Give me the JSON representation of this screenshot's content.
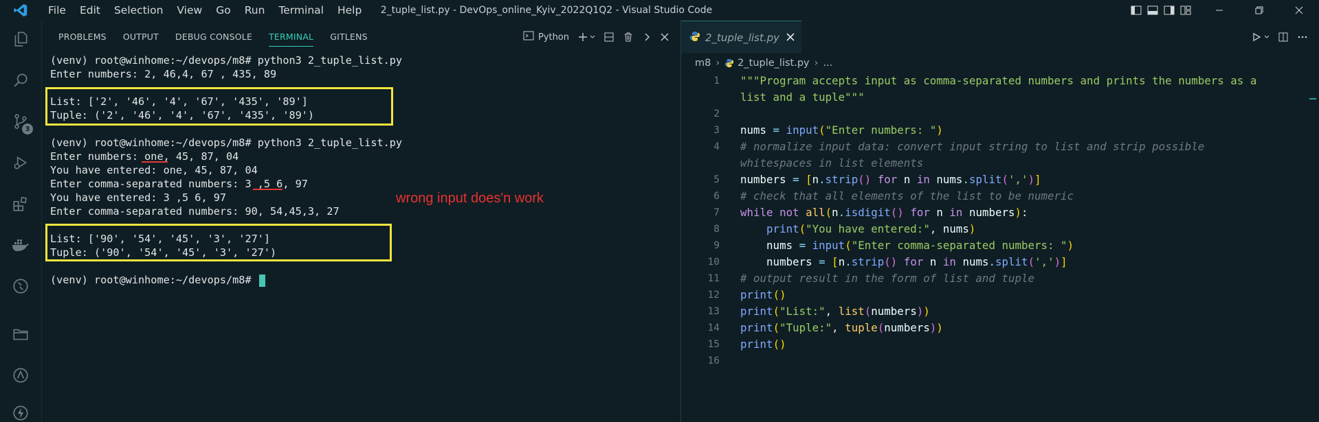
{
  "titlebar": {
    "menu": [
      "File",
      "Edit",
      "Selection",
      "View",
      "Go",
      "Run",
      "Terminal",
      "Help"
    ],
    "window_title": "2_tuple_list.py - DevOps_online_Kyiv_2022Q1Q2 - Visual Studio Code"
  },
  "activity_bar": {
    "source_control_badge": "3"
  },
  "panel": {
    "tabs": [
      "PROBLEMS",
      "OUTPUT",
      "DEBUG CONSOLE",
      "TERMINAL",
      "GITLENS"
    ],
    "active_tab": "TERMINAL",
    "shell_label": "Python"
  },
  "terminal": {
    "lines": [
      "(venv) root@winhome:~/devops/m8# python3 2_tuple_list.py",
      "Enter numbers: 2, 46,4, 67 , 435, 89",
      "",
      "List: ['2', '46', '4', '67', '435', '89']",
      "Tuple: ('2', '46', '4', '67', '435', '89')",
      "",
      "(venv) root@winhome:~/devops/m8# python3 2_tuple_list.py",
      "Enter numbers: one, 45, 87, 04",
      "You have entered: one, 45, 87, 04",
      "Enter comma-separated numbers: 3 ,5 6, 97",
      "You have entered: 3 ,5 6, 97",
      "Enter comma-separated numbers: 90, 54,45,3, 27",
      "",
      "List: ['90', '54', '45', '3', '27']",
      "Tuple: ('90', '54', '45', '3', '27')",
      "",
      "(venv) root@winhome:~/devops/m8# "
    ],
    "annotation": "wrong input does'n work"
  },
  "editor": {
    "tab_label": "2_tuple_list.py",
    "breadcrumb": {
      "folder": "m8",
      "file": "2_tuple_list.py",
      "rest": "..."
    },
    "line_numbers": [
      "1",
      "",
      "2",
      "3",
      "4",
      "",
      "5",
      "6",
      "7",
      "8",
      "9",
      "10",
      "11",
      "12",
      "13",
      "14",
      "15",
      "16"
    ]
  },
  "colors": {
    "background": "#0f1e24",
    "accent": "#35d0c0",
    "highlight_box": "#f6e53e",
    "annotation": "#e8322f"
  }
}
